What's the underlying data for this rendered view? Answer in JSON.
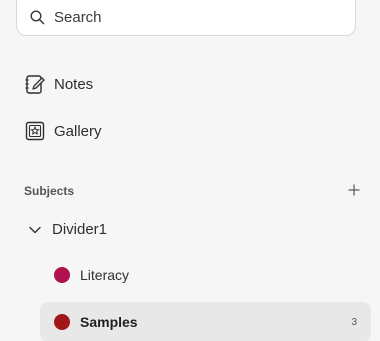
{
  "search": {
    "placeholder": "Search",
    "icon": "search-icon"
  },
  "nav": {
    "items": [
      {
        "label": "Notes",
        "icon": "notes-icon"
      },
      {
        "label": "Gallery",
        "icon": "gallery-icon"
      }
    ]
  },
  "subjects": {
    "title": "Subjects",
    "add_icon": "plus-icon",
    "folder": {
      "label": "Divider1",
      "expanded": true,
      "icon": "chevron-down-icon"
    },
    "items": [
      {
        "label": "Literacy",
        "color": "#b0124e",
        "count": "",
        "selected": false
      },
      {
        "label": "Samples",
        "color": "#a11616",
        "count": "3",
        "selected": true
      }
    ]
  },
  "colors": {
    "background": "#f6f6f6",
    "selected_row": "#e8e8e8",
    "text": "#2f2f2f"
  }
}
